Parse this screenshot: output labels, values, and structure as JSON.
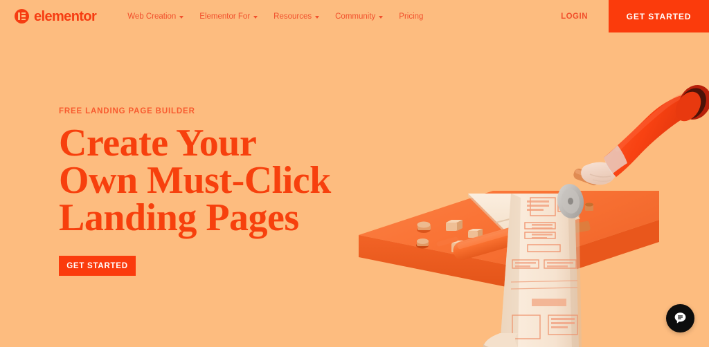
{
  "brand": {
    "name": "elementor",
    "accent": "#F63C11",
    "cta_bg": "#FB3B0C",
    "page_bg": "#FDBC7F",
    "heading_color": "#F7400D",
    "nav_link_color": "#F1502C"
  },
  "navbar": {
    "logo_label": "elementor",
    "links": [
      {
        "label": "Web Creation",
        "has_dropdown": true
      },
      {
        "label": "Elementor For",
        "has_dropdown": true
      },
      {
        "label": "Resources",
        "has_dropdown": true
      },
      {
        "label": "Community",
        "has_dropdown": true
      },
      {
        "label": "Pricing",
        "has_dropdown": false
      }
    ],
    "login_label": "LOGIN",
    "cta_label": "GET STARTED"
  },
  "hero": {
    "eyebrow": "FREE LANDING PAGE BUILDER",
    "headline_lines": [
      "Create Your",
      "Own Must-Click",
      "Landing Pages"
    ],
    "cta_label": "GET STARTED"
  },
  "illustration": {
    "description": "3D render of an orange table with a rolling pin, a hand holding a pizza cutter, and a long cream dough strip printed with web page wireframe blocks unrolling off the table edge",
    "colors": {
      "table_top": "#F97438",
      "table_edge": "#EE5B23",
      "rolling_pin": "#F96A2B",
      "sleeve": "#F53F10",
      "hand": "#F3D7C8",
      "dough": "#F7E6D4",
      "wireframe_line": "#F08A63"
    }
  },
  "chat": {
    "icon": "chat-bubble-icon",
    "bg": "#0D0D0D"
  }
}
